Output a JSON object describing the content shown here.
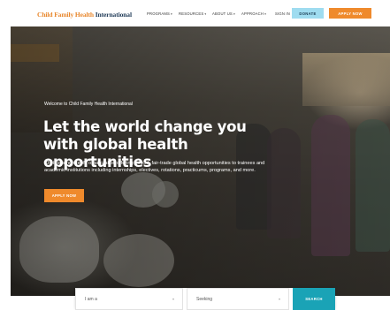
{
  "header": {
    "logo": {
      "part1": "Child Family Health",
      "part2": "International"
    },
    "nav": [
      {
        "label": "PROGRAMS",
        "has_dropdown": true
      },
      {
        "label": "RESOURCES",
        "has_dropdown": true
      },
      {
        "label": "ABOUT US",
        "has_dropdown": true
      },
      {
        "label": "APPROACH",
        "has_dropdown": true
      },
      {
        "label": "SIGN IN",
        "has_dropdown": false
      }
    ],
    "donate_label": "DONATE",
    "apply_label": "APPLY NOW"
  },
  "hero": {
    "eyebrow": "Welcome to Child Family Health International",
    "title": "Let the world change you with global health opportunities",
    "description": "CFHI is a non-profit organization offering ethical, fair-trade global health opportunities to trainees and academic institutions including internships, electives, rotations, practicums, programs, and more.",
    "cta_label": "APPLY NOW"
  },
  "search": {
    "role_select": "I am a",
    "seeking_select": "Seeking",
    "button_label": "SEARCH"
  },
  "colors": {
    "orange": "#ef8a2c",
    "light_blue": "#9fdcf0",
    "teal": "#1aa3b6",
    "navy": "#1f3a57"
  },
  "icons": {
    "dropdown": "chevron-down-icon"
  }
}
